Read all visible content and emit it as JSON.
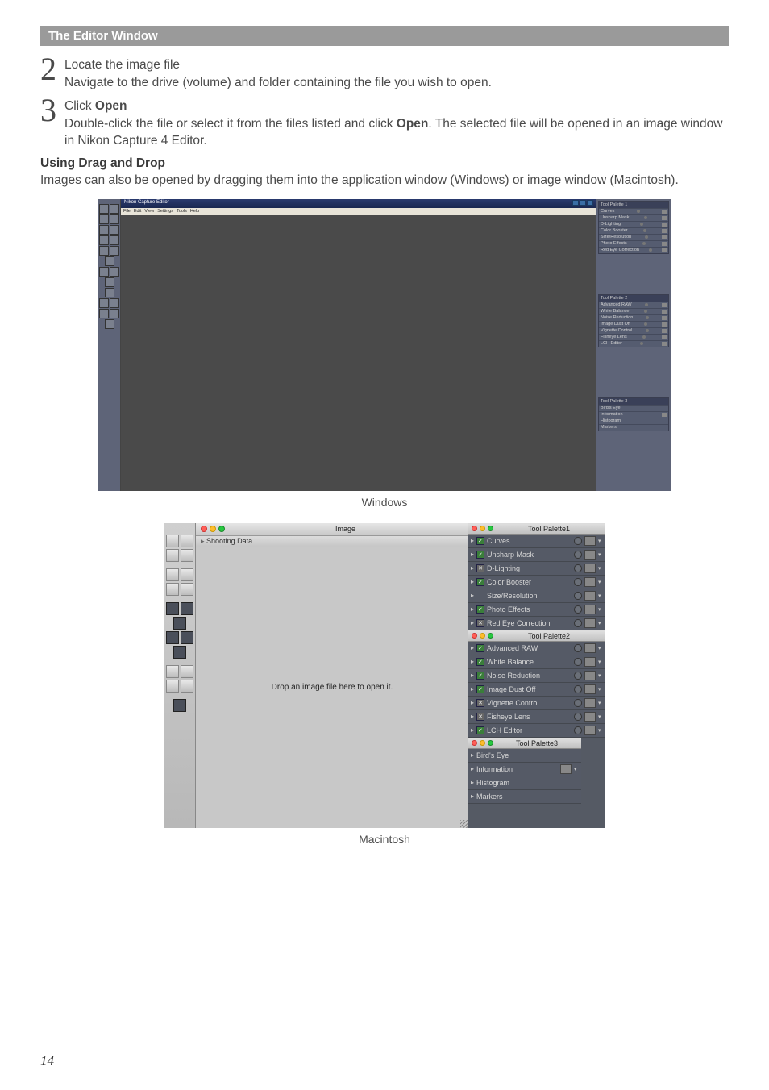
{
  "header": "The Editor Window",
  "steps": [
    {
      "num": "2",
      "title": "Locate the image file",
      "body": "Navigate to the drive (volume) and folder containing the file you wish to open."
    },
    {
      "num": "3",
      "title_prefix": "Click ",
      "title_bold": "Open",
      "body_pre": "Double-click the file or select it from the files listed and click ",
      "body_bold": "Open",
      "body_post": ".  The selected file will be opened in an image window in Nikon Capture 4 Editor."
    }
  ],
  "dragdrop": {
    "heading": "Using Drag and Drop",
    "body": "Images can also be opened by dragging them into the application window (Windows) or image window (Macintosh)."
  },
  "captions": {
    "windows": "Windows",
    "macintosh": "Macintosh"
  },
  "page_number": "14",
  "windows_shot": {
    "app_title": "Nikon Capture Editor",
    "menus": [
      "File",
      "Edit",
      "View",
      "Settings",
      "Tools",
      "Help"
    ],
    "palette1": {
      "title": "Tool Palette 1",
      "rows": [
        "Curves",
        "Unsharp Mask",
        "D-Lighting",
        "Color Booster",
        "Size/Resolution",
        "Photo Effects",
        "Red Eye Correction"
      ]
    },
    "palette2": {
      "title": "Tool Palette 2",
      "rows": [
        "Advanced RAW",
        "White Balance",
        "Noise Reduction",
        "Image Dust Off",
        "Vignette Control",
        "Fisheye Lens",
        "LCH Editor"
      ]
    },
    "palette3": {
      "title": "Tool Palette 3",
      "rows": [
        "Bird's Eye",
        "Information",
        "Histogram",
        "Markers"
      ]
    }
  },
  "mac_shot": {
    "image_title": "Image",
    "shooting": "Shooting Data",
    "canvas_hint": "Drop an image file here to open it.",
    "palette1": {
      "title": "Tool Palette1",
      "rows": [
        {
          "label": "Curves",
          "chk": "on"
        },
        {
          "label": "Unsharp Mask",
          "chk": "on"
        },
        {
          "label": "D-Lighting",
          "chk": "x"
        },
        {
          "label": "Color Booster",
          "chk": "on"
        },
        {
          "label": "Size/Resolution",
          "chk": "none"
        },
        {
          "label": "Photo Effects",
          "chk": "on"
        },
        {
          "label": "Red Eye Correction",
          "chk": "x"
        }
      ]
    },
    "palette2": {
      "title": "Tool Palette2",
      "rows": [
        {
          "label": "Advanced RAW",
          "chk": "on"
        },
        {
          "label": "White Balance",
          "chk": "on"
        },
        {
          "label": "Noise Reduction",
          "chk": "on"
        },
        {
          "label": "Image Dust Off",
          "chk": "on"
        },
        {
          "label": "Vignette Control",
          "chk": "x"
        },
        {
          "label": "Fisheye Lens",
          "chk": "x"
        },
        {
          "label": "LCH Editor",
          "chk": "on"
        }
      ]
    },
    "palette3": {
      "title": "Tool Palette3",
      "rows": [
        {
          "label": "Bird's Eye"
        },
        {
          "label": "Information",
          "pg": true
        },
        {
          "label": "Histogram"
        },
        {
          "label": "Markers"
        }
      ]
    }
  }
}
